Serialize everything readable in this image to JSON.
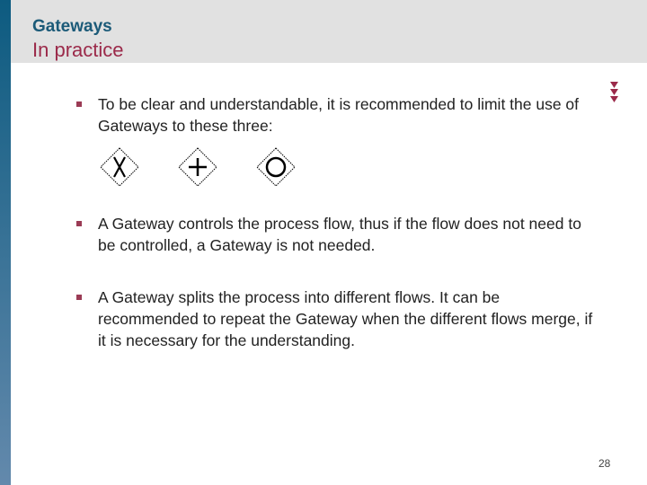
{
  "header": {
    "title": "Gateways",
    "subtitle": "In practice"
  },
  "colors": {
    "accent": "#9b2a4a",
    "title": "#1b5a78",
    "header_bg": "#e1e1e1"
  },
  "bullets": [
    "To be clear and understandable, it is recommended to limit the use of Gateways to these three:",
    "A Gateway controls the process flow, thus if the flow does not need to be controlled, a Gateway is not needed.",
    "A Gateway splits the process into different flows. It can be recommended to repeat the Gateway when the different flows merge, if it is necessary for the understanding."
  ],
  "gateway_icons": [
    "exclusive-gateway-icon",
    "parallel-gateway-icon",
    "inclusive-gateway-icon"
  ],
  "gateway_labels": [
    "X",
    "+",
    "O"
  ],
  "page_number": "28"
}
